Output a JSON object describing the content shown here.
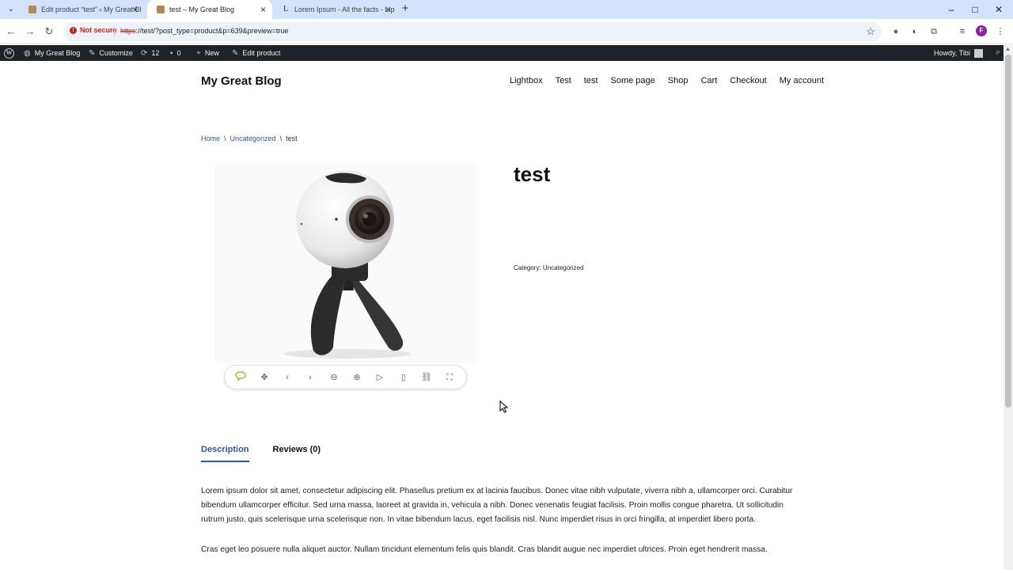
{
  "browser": {
    "tabs": [
      {
        "title": "Edit product “test” ‹ My Great Bl",
        "favicon": "wordpress-icon",
        "active": false
      },
      {
        "title": "test – My Great Blog",
        "favicon": "wordpress-icon",
        "active": true
      },
      {
        "title": "Lorem Ipsum - All the facts - Lip",
        "favicon": "lorem-icon",
        "active": false
      }
    ],
    "security_label": "Not secure",
    "url_scheme": "https",
    "url_rest": "://test/?post_type=product&p=639&preview=true",
    "profile_initial": "F"
  },
  "adminbar": {
    "site_name": "My Great Blog",
    "customize": "Customize",
    "updates_count": "12",
    "comments_count": "0",
    "new_label": "New",
    "edit_label": "Edit product",
    "howdy": "Howdy, Tibi"
  },
  "site": {
    "title": "My Great Blog",
    "nav": [
      "Lightbox",
      "Test",
      "test",
      "Some page",
      "Shop",
      "Cart",
      "Checkout",
      "My account"
    ]
  },
  "breadcrumb": {
    "items": [
      "Home",
      "Uncategorized",
      "test"
    ],
    "separator": "\\"
  },
  "product": {
    "title": "test",
    "category_label": "Category:",
    "category": "Uncategorized"
  },
  "lightbox_toolbar": [
    "comment-icon",
    "move-icon",
    "prev-icon",
    "next-icon",
    "zoom-out-icon",
    "zoom-in-icon",
    "play-icon",
    "thumbnails-icon",
    "link-icon",
    "fullscreen-icon"
  ],
  "product_tabs": [
    {
      "label": "Description",
      "active": true
    },
    {
      "label": "Reviews (0)",
      "active": false
    }
  ],
  "description": [
    "Lorem ipsum dolor sit amet, consectetur adipiscing elit. Phasellus pretium ex at lacinia faucibus. Donec vitae nibh vulputate, viverra nibh a, ullamcorper orci. Curabitur bibendum ullamcorper efficitur. Sed urna massa, laoreet at gravida in, vehicula a nibh. Donec venenatis feugiat facilisis. Proin mollis congue pharetra. Ut sollicitudin rutrum justo, quis scelerisque urna scelerisque non. In vitae bibendum lacus, eget facilisis nisl. Nunc imperdiet risus in orci fringilla, at imperdiet libero porta.",
    "Cras eget leo posuere nulla aliquet auctor. Nullam tincidunt elementum felis quis blandit. Cras blandit augue nec imperdiet ultrices. Proin eget hendrerit massa."
  ],
  "colors": {
    "accent": "#2c57a6",
    "adminbar_bg": "#1d2327",
    "tabstrip_bg": "#d3e3fd",
    "lightbox_active": "#8bc34a"
  }
}
